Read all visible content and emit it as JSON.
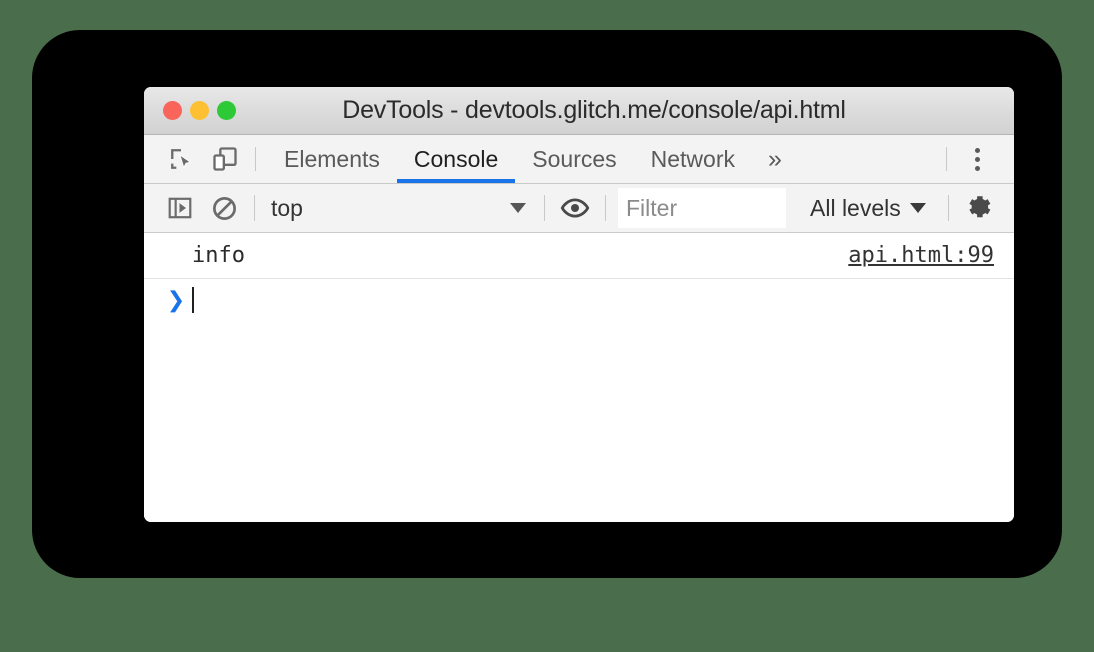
{
  "window": {
    "title": "DevTools - devtools.glitch.me/console/api.html",
    "traffic_lights": [
      {
        "name": "close",
        "color": "#f9655b"
      },
      {
        "name": "minimize",
        "color": "#fcc032"
      },
      {
        "name": "maximize",
        "color": "#2dc937"
      }
    ]
  },
  "tab_bar": {
    "icons": [
      {
        "name": "inspect-element-icon",
        "title": "Inspect element"
      },
      {
        "name": "device-toolbar-icon",
        "title": "Toggle device toolbar"
      }
    ],
    "tabs": [
      {
        "label": "Elements",
        "active": false
      },
      {
        "label": "Console",
        "active": true
      },
      {
        "label": "Sources",
        "active": false
      },
      {
        "label": "Network",
        "active": false
      }
    ],
    "overflow_label": "»",
    "menu": {
      "name": "main-menu",
      "label": "Customize and control DevTools"
    },
    "active_underline_color": "#1a73e8"
  },
  "console_toolbar": {
    "sidebar_toggle": {
      "name": "console-sidebar-toggle-icon"
    },
    "clear_console": {
      "name": "clear-console-icon"
    },
    "context": {
      "value": "top",
      "caret": "▼"
    },
    "live_expression": {
      "name": "eye-icon"
    },
    "filter": {
      "value": "",
      "placeholder": "Filter"
    },
    "levels": {
      "value": "All levels",
      "caret": "▼"
    },
    "settings": {
      "name": "gear-icon"
    }
  },
  "console": {
    "messages": [
      {
        "text": "info",
        "source": "api.html:99"
      }
    ],
    "prompt": {
      "chevron": "❯",
      "value": ""
    }
  },
  "colors": {
    "page_background": "#4a6e4c",
    "frame": "#000000",
    "panel": "#ffffff",
    "toolbar": "#f3f3f3",
    "accent": "#1a73e8"
  }
}
